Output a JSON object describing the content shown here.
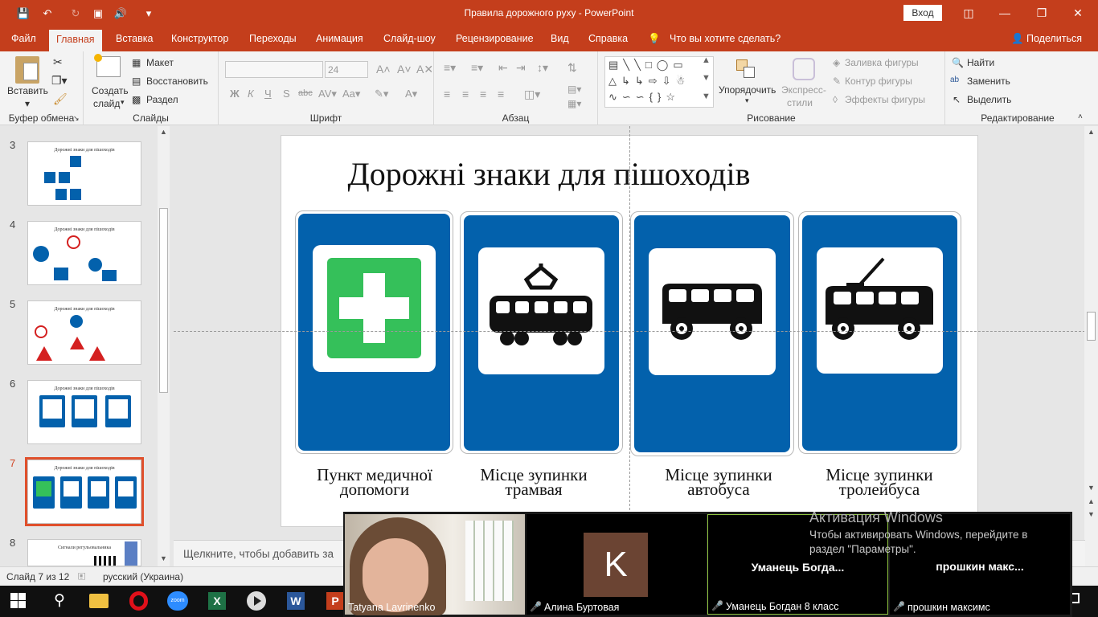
{
  "window": {
    "title": "Правила дорожного руху  -  PowerPoint",
    "signin": "Вход"
  },
  "tabs": [
    "Файл",
    "Главная",
    "Вставка",
    "Конструктор",
    "Переходы",
    "Анимация",
    "Слайд-шоу",
    "Рецензирование",
    "Вид",
    "Справка"
  ],
  "tell_me": "Что вы хотите сделать?",
  "share": "Поделиться",
  "ribbon": {
    "clipboard": {
      "paste": "Вставить",
      "label": "Буфер обмена"
    },
    "slides": {
      "new_slide_1": "Создать",
      "new_slide_2": "слайд",
      "layout": "Макет",
      "reset": "Восстановить",
      "section": "Раздел",
      "label": "Слайды"
    },
    "font": {
      "size": "24",
      "bold": "Ж",
      "italic": "К",
      "underline": "Ч",
      "shadow": "S",
      "strike": "abc",
      "label": "Шрифт"
    },
    "paragraph": {
      "label": "Абзац"
    },
    "drawing": {
      "arrange": "Упорядочить",
      "quick_1": "Экспресс-",
      "quick_2": "стили",
      "fill": "Заливка фигуры",
      "outline": "Контур фигуры",
      "effects": "Эффекты фигуры",
      "label": "Рисование"
    },
    "editing": {
      "find": "Найти",
      "replace": "Заменить",
      "select": "Выделить",
      "label": "Редактирование"
    }
  },
  "thumbnails": [
    {
      "num": "3",
      "title": "Дорожні знаки для пішоходів"
    },
    {
      "num": "4",
      "title": "Дорожні знаки для пішоходів"
    },
    {
      "num": "5",
      "title": "Дорожні знаки для пішоходів"
    },
    {
      "num": "6",
      "title": "Дорожні знаки для пішоходів"
    },
    {
      "num": "7",
      "title": "Дорожні знаки для пішоходів"
    },
    {
      "num": "8",
      "title": "Сигнали регульовальника"
    }
  ],
  "slide": {
    "title": "Дорожні знаки для пішоходів",
    "signs": [
      {
        "line1": "Пункт медичної",
        "line2": "допомоги",
        "icon": "first-aid-icon"
      },
      {
        "line1": "Місце зупинки",
        "line2": "трамвая",
        "icon": "tram-icon"
      },
      {
        "line1": "Місце зупинки",
        "line2": "автобуса",
        "icon": "bus-icon"
      },
      {
        "line1": "Місце зупинки",
        "line2": "тролейбуса",
        "icon": "trolleybus-icon"
      }
    ],
    "sign_blue": "#0361ac",
    "aid_green": "#35c05a"
  },
  "notes_placeholder": "Щелкните, чтобы добавить за",
  "status": {
    "slide": "Слайд 7 из 12",
    "lang": "русский (Украина)"
  },
  "zoom_call": {
    "participants": [
      {
        "name": "Tatyana Lavrinenko"
      },
      {
        "name": "Алина Буртовая",
        "initial": "K"
      },
      {
        "name": "Уманець Богдан 8 класс",
        "short": "Уманець  Богда..."
      },
      {
        "name": "прошкин максимс",
        "short": "прошкин  макс..."
      }
    ]
  },
  "watermark": {
    "title": "Активация Windows",
    "line1": "Чтобы активировать Windows, перейдите в",
    "line2": "раздел \"Параметры\"."
  }
}
